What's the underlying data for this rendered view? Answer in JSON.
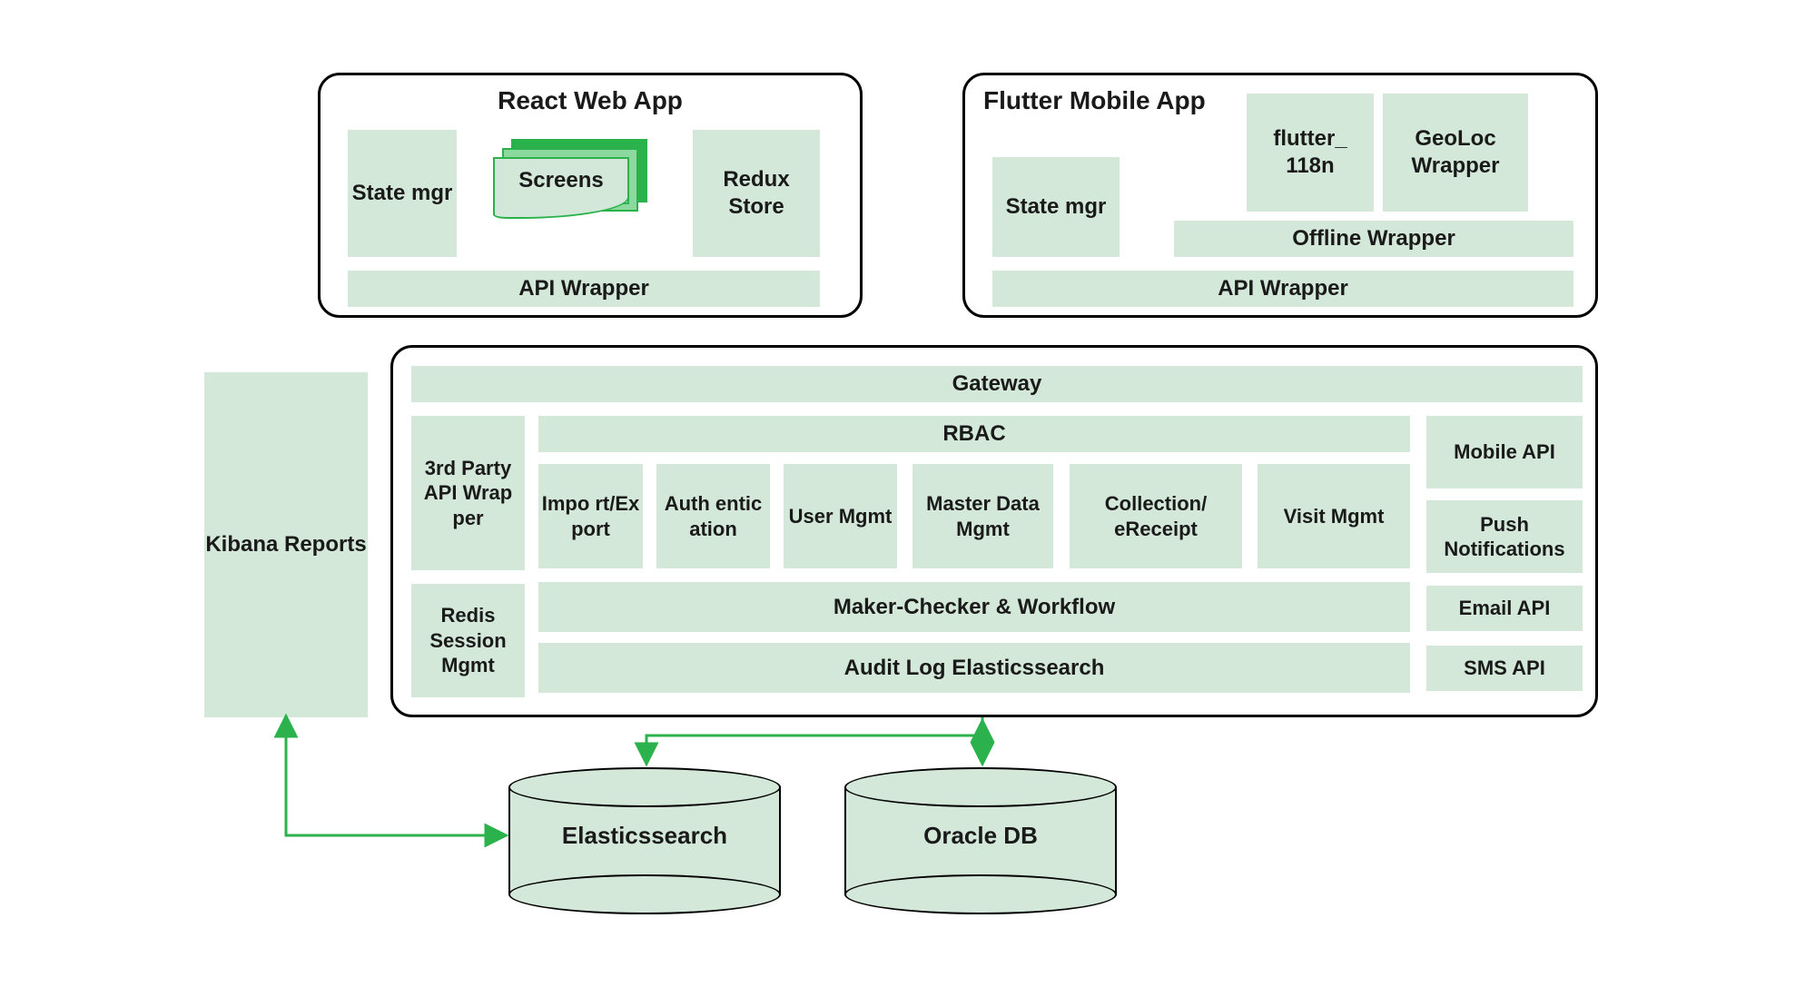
{
  "react": {
    "title": "React Web App",
    "state_mgr": "State mgr",
    "screens": "Screens",
    "redux": "Redux Store",
    "api_wrapper": "API Wrapper"
  },
  "flutter": {
    "title": "Flutter Mobile App",
    "state_mgr": "State mgr",
    "i18n": "flutter_ 118n",
    "geoloc": "GeoLoc Wrapper",
    "offline": "Offline Wrapper",
    "api_wrapper": "API Wrapper"
  },
  "kibana": "Kibana Reports",
  "gateway": {
    "gateway": "Gateway",
    "third_party": "3rd Party API Wrap per",
    "redis": "Redis Session Mgmt",
    "rbac": "RBAC",
    "import_export": "Impo rt/Ex port",
    "auth": "Auth entic ation",
    "user_mgmt": "User Mgmt",
    "master_data": "Master Data Mgmt",
    "collection": "Collection/ eReceipt",
    "visit": "Visit Mgmt",
    "maker_checker": "Maker-Checker & Workflow",
    "audit_log": "Audit Log Elasticssearch",
    "mobile_api": "Mobile API",
    "push": "Push Notifications",
    "email": "Email API",
    "sms": "SMS API"
  },
  "db": {
    "elasticsearch": "Elasticssearch",
    "oracle": "Oracle DB"
  }
}
